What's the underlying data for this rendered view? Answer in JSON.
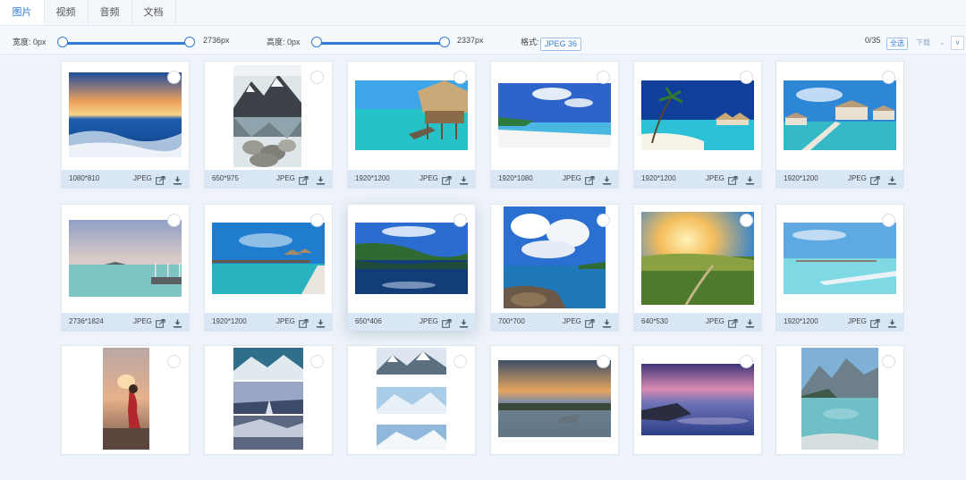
{
  "tabs": [
    "图片",
    "视频",
    "音频",
    "文档"
  ],
  "filter": {
    "width_label": "宽度: 0px",
    "width_max": "2736px",
    "height_label": "高度: 0px",
    "height_max": "2337px",
    "format_label": "格式:",
    "format_value": "JPEG 36",
    "count": "0/35",
    "select_all": "全选",
    "download": "下载",
    "dropdown_arrow": "⌄",
    "dropdown_caret": "∨"
  },
  "colors": {
    "accent": "#2f7dd8",
    "footer": "#d8e6f5",
    "background": "#eef3f9"
  },
  "images": [
    {
      "dim": "1080*810",
      "type": "JPEG",
      "scene": "ocean-sunset"
    },
    {
      "dim": "650*975",
      "type": "JPEG",
      "scene": "mountain-lake-portrait"
    },
    {
      "dim": "1920*1200",
      "type": "JPEG",
      "scene": "overwater-hut"
    },
    {
      "dim": "1920*1080",
      "type": "JPEG",
      "scene": "white-beach"
    },
    {
      "dim": "1920*1200",
      "type": "JPEG",
      "scene": "palm-beach-huts"
    },
    {
      "dim": "1920*1200",
      "type": "JPEG",
      "scene": "water-villas"
    },
    {
      "dim": "2736*1824",
      "type": "JPEG",
      "scene": "calm-sea-pier"
    },
    {
      "dim": "1920*1200",
      "type": "JPEG",
      "scene": "lagoon-resort"
    },
    {
      "dim": "650*406",
      "type": "JPEG",
      "scene": "hill-reflection"
    },
    {
      "dim": "700*700",
      "type": "JPEG",
      "scene": "cloudy-coast"
    },
    {
      "dim": "640*530",
      "type": "JPEG",
      "scene": "sunrise-grassland"
    },
    {
      "dim": "1920*1200",
      "type": "JPEG",
      "scene": "turquoise-lagoon"
    },
    {
      "dim": "",
      "type": "",
      "scene": "girl-sunset-portrait"
    },
    {
      "dim": "",
      "type": "",
      "scene": "snow-mountain-collage"
    },
    {
      "dim": "",
      "type": "",
      "scene": "snow-peaks-collage"
    },
    {
      "dim": "",
      "type": "",
      "scene": "dramatic-sky-lake"
    },
    {
      "dim": "",
      "type": "",
      "scene": "purple-sunset-coast"
    },
    {
      "dim": "",
      "type": "",
      "scene": "alpine-lake-portrait"
    }
  ]
}
